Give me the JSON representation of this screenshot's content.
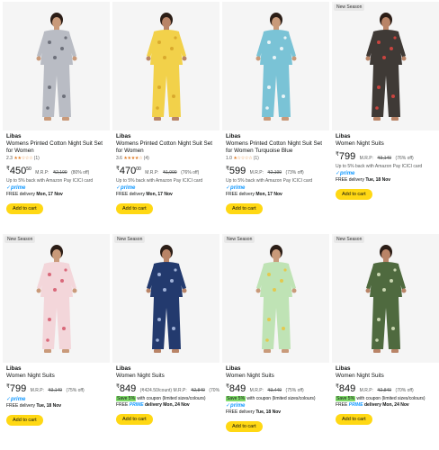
{
  "colors": {
    "accent_button": "#ffd814",
    "prime_blue": "#1399ff",
    "star": "#de7921",
    "coupon_green": "#7fda69"
  },
  "products": [
    {
      "badge": "",
      "brand": "Libas",
      "title": "Womens Printed Cotton Night Suit Set for Women",
      "rating_value": "2.3",
      "stars": "★★☆☆☆",
      "rating_count": "(1)",
      "price_currency": "₹",
      "price_whole": "450",
      "price_fraction": "50",
      "mrp_label": "M.R.P:",
      "mrp": "₹2,199",
      "discount": "(80% off)",
      "offer": "Up to 5% back with Amazon Pay ICICI card",
      "coupon": "",
      "coupon_text": "",
      "prime": "✓prime",
      "delivery_prefix": "FREE delivery",
      "delivery_prime": "",
      "delivery_date": "Mon, 17 Nov",
      "add_to_cart": "Add to cart",
      "garment_color": "#b9bcc4",
      "pattern_color": "#6d707a",
      "skin": "#c99a7a"
    },
    {
      "badge": "",
      "brand": "Libas",
      "title": "Womens Printed Cotton Night Suit Set for Women",
      "rating_value": "3.6",
      "stars": "★★★★☆",
      "rating_count": "(4)",
      "price_currency": "₹",
      "price_whole": "470",
      "price_fraction": "00",
      "mrp_label": "M.R.P:",
      "mrp": "₹1,999",
      "discount": "(76% off)",
      "offer": "Up to 5% back with Amazon Pay ICICI card",
      "coupon": "",
      "coupon_text": "",
      "prime": "✓prime",
      "delivery_prefix": "FREE delivery",
      "delivery_prime": "",
      "delivery_date": "Mon, 17 Nov",
      "add_to_cart": "Add to cart",
      "garment_color": "#f2d14a",
      "pattern_color": "#d9a92c",
      "skin": "#b98467"
    },
    {
      "badge": "",
      "brand": "Libas",
      "title": "Womens Printed Cotton Night Suit Set for Women Turquoise Blue",
      "rating_value": "1.0",
      "stars": "★☆☆☆☆",
      "rating_count": "(1)",
      "price_currency": "₹",
      "price_whole": "599",
      "price_fraction": "",
      "mrp_label": "M.R.P:",
      "mrp": "₹2,199",
      "discount": "(73% off)",
      "offer": "Up to 5% back with Amazon Pay ICICI card",
      "coupon": "",
      "coupon_text": "",
      "prime": "✓prime",
      "delivery_prefix": "FREE delivery",
      "delivery_prime": "",
      "delivery_date": "Mon, 17 Nov",
      "add_to_cart": "Add to cart",
      "garment_color": "#7ac3d6",
      "pattern_color": "#e8f3f6",
      "skin": "#c99a7a"
    },
    {
      "badge": "New Season",
      "brand": "Libas",
      "title": "Women Night Suits",
      "rating_value": "",
      "stars": "",
      "rating_count": "",
      "price_currency": "₹",
      "price_whole": "799",
      "price_fraction": "",
      "mrp_label": "M.R.P:",
      "mrp": "₹3,149",
      "discount": "(76% off)",
      "offer": "Up to 5% back with Amazon Pay ICICI card",
      "coupon": "",
      "coupon_text": "",
      "prime": "✓prime",
      "delivery_prefix": "FREE delivery",
      "delivery_prime": "",
      "delivery_date": "Tue, 18 Nov",
      "add_to_cart": "Add to cart",
      "garment_color": "#3f3a36",
      "pattern_color": "#c8443f",
      "skin": "#b98467"
    },
    {
      "badge": "New Season",
      "brand": "Libas",
      "title": "Women Night Suits",
      "rating_value": "",
      "stars": "",
      "rating_count": "",
      "price_currency": "₹",
      "price_whole": "799",
      "price_fraction": "",
      "mrp_label": "M.R.P:",
      "mrp": "₹3,149",
      "discount": "(75% off)",
      "offer": "",
      "coupon": "",
      "coupon_text": "",
      "prime": "✓prime",
      "delivery_prefix": "FREE delivery",
      "delivery_prime": "",
      "delivery_date": "Tue, 18 Nov",
      "add_to_cart": "Add to cart",
      "garment_color": "#f3d6da",
      "pattern_color": "#d9687a",
      "skin": "#c99a7a"
    },
    {
      "badge": "New Season",
      "brand": "Libas",
      "title": "Women Night Suits",
      "rating_value": "",
      "stars": "",
      "rating_count": "",
      "price_currency": "₹",
      "price_whole": "849",
      "price_fraction": "",
      "mrp_label": "(₹424.50/count) M.R.P:",
      "mrp": "₹2,849",
      "discount": "(70% off)",
      "offer": "",
      "coupon": "Save 5%",
      "coupon_text": "with coupon (limited sizes/colours)",
      "prime": "",
      "delivery_prefix": "FREE",
      "delivery_prime": "PRIME",
      "delivery_date": "delivery Mon, 24 Nov",
      "add_to_cart": "Add to cart",
      "garment_color": "#233a6e",
      "pattern_color": "#9fb1d8",
      "skin": "#b98467"
    },
    {
      "badge": "New Season",
      "brand": "Libas",
      "title": "Women Night Suits",
      "rating_value": "",
      "stars": "",
      "rating_count": "",
      "price_currency": "₹",
      "price_whole": "849",
      "price_fraction": "",
      "mrp_label": "M.R.P:",
      "mrp": "₹3,449",
      "discount": "(75% off)",
      "offer": "",
      "coupon": "Save 5%",
      "coupon_text": "with coupon (limited sizes/colours)",
      "prime": "✓prime",
      "delivery_prefix": "FREE delivery",
      "delivery_prime": "",
      "delivery_date": "Tue, 18 Nov",
      "add_to_cart": "Add to cart",
      "garment_color": "#bfe3b5",
      "pattern_color": "#e3c94e",
      "skin": "#c99a7a"
    },
    {
      "badge": "New Season",
      "brand": "Libas",
      "title": "Women Night Suits",
      "rating_value": "",
      "stars": "",
      "rating_count": "",
      "price_currency": "₹",
      "price_whole": "849",
      "price_fraction": "",
      "mrp_label": "M.R.P:",
      "mrp": "₹2,849",
      "discount": "(70% off)",
      "offer": "",
      "coupon": "Save 5%",
      "coupon_text": "with coupon (limited sizes/colours)",
      "prime": "",
      "delivery_prefix": "FREE",
      "delivery_prime": "PRIME",
      "delivery_date": "delivery Mon, 24 Nov",
      "add_to_cart": "Add to cart",
      "garment_color": "#4f6a3f",
      "pattern_color": "#c9d6b0",
      "skin": "#b98467"
    }
  ]
}
